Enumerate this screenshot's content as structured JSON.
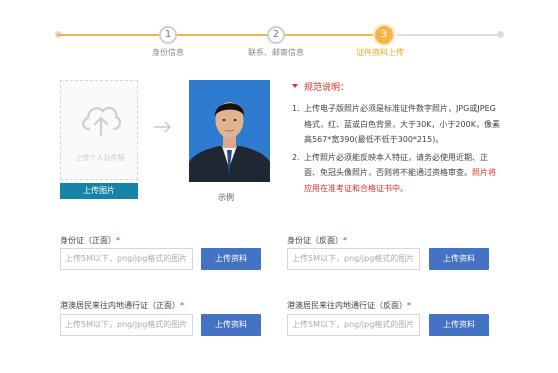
{
  "stepper": {
    "steps": [
      {
        "number": "1",
        "label": "身份信息"
      },
      {
        "number": "2",
        "label": "联系、邮寄信息"
      },
      {
        "number": "3",
        "label": "证件资料上传"
      }
    ],
    "active_color": "#f5b44a"
  },
  "upload": {
    "hint": "上传个人证件照",
    "button": "上传图片"
  },
  "sample": {
    "label": "示例"
  },
  "spec": {
    "title": "规范说明：",
    "items": [
      {
        "num": "1.",
        "text": "上传电子版照片必须是标准证件数字照片，JPG或JPEG格式，红、蓝或白色背景，大于30K，小于200K，像素高567*宽390(最低不低于300*215)。"
      },
      {
        "num": "2.",
        "text": "上传照片必须能反映本人特征，请务必使用近期、正面、免冠头像照片，否则将不能通过资格审查。",
        "red": "照片将应用在准考证和合格证书中。"
      }
    ]
  },
  "fields": [
    {
      "label": "身份证（正面）",
      "required": "*",
      "placeholder": "上传5M以下，png/jpg格式的图片",
      "button": "上传资料"
    },
    {
      "label": "身份证（反面）",
      "required": "*",
      "placeholder": "上传5M以下，png/jpg格式的图片",
      "button": "上传资料"
    },
    {
      "label": "港澳居民来往内地通行证（正面）",
      "required": "*",
      "placeholder": "上传5M以下，png/jpg格式的图片",
      "button": "上传资料"
    },
    {
      "label": "港澳居民来往内地通行证（反面）",
      "required": "*",
      "placeholder": "上传5M以下，png/jpg格式的图片",
      "button": "上传资料"
    }
  ],
  "colors": {
    "accent": "#f5b44a",
    "upload_button": "#1684a8",
    "field_button": "#4472c4",
    "warning": "#d9302b"
  }
}
